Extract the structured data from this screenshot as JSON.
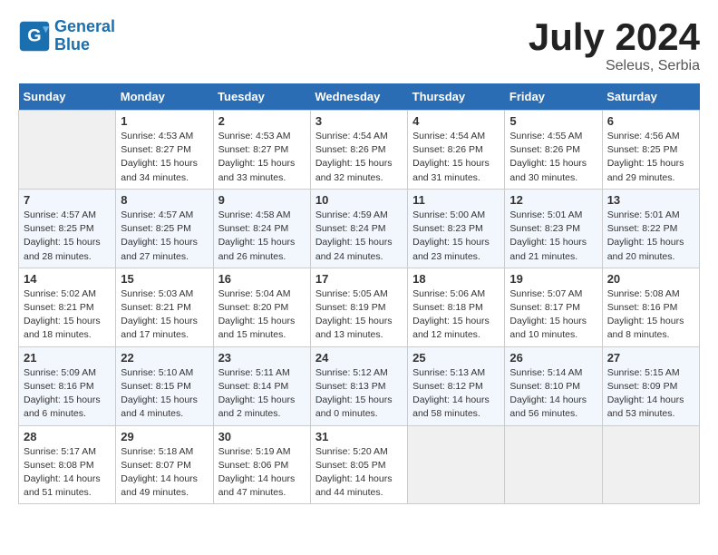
{
  "logo": {
    "line1": "General",
    "line2": "Blue"
  },
  "title": "July 2024",
  "subtitle": "Seleus, Serbia",
  "headers": [
    "Sunday",
    "Monday",
    "Tuesday",
    "Wednesday",
    "Thursday",
    "Friday",
    "Saturday"
  ],
  "weeks": [
    [
      {
        "day": "",
        "sunrise": "",
        "sunset": "",
        "daylight": ""
      },
      {
        "day": "1",
        "sunrise": "Sunrise: 4:53 AM",
        "sunset": "Sunset: 8:27 PM",
        "daylight": "Daylight: 15 hours and 34 minutes."
      },
      {
        "day": "2",
        "sunrise": "Sunrise: 4:53 AM",
        "sunset": "Sunset: 8:27 PM",
        "daylight": "Daylight: 15 hours and 33 minutes."
      },
      {
        "day": "3",
        "sunrise": "Sunrise: 4:54 AM",
        "sunset": "Sunset: 8:26 PM",
        "daylight": "Daylight: 15 hours and 32 minutes."
      },
      {
        "day": "4",
        "sunrise": "Sunrise: 4:54 AM",
        "sunset": "Sunset: 8:26 PM",
        "daylight": "Daylight: 15 hours and 31 minutes."
      },
      {
        "day": "5",
        "sunrise": "Sunrise: 4:55 AM",
        "sunset": "Sunset: 8:26 PM",
        "daylight": "Daylight: 15 hours and 30 minutes."
      },
      {
        "day": "6",
        "sunrise": "Sunrise: 4:56 AM",
        "sunset": "Sunset: 8:25 PM",
        "daylight": "Daylight: 15 hours and 29 minutes."
      }
    ],
    [
      {
        "day": "7",
        "sunrise": "Sunrise: 4:57 AM",
        "sunset": "Sunset: 8:25 PM",
        "daylight": "Daylight: 15 hours and 28 minutes."
      },
      {
        "day": "8",
        "sunrise": "Sunrise: 4:57 AM",
        "sunset": "Sunset: 8:25 PM",
        "daylight": "Daylight: 15 hours and 27 minutes."
      },
      {
        "day": "9",
        "sunrise": "Sunrise: 4:58 AM",
        "sunset": "Sunset: 8:24 PM",
        "daylight": "Daylight: 15 hours and 26 minutes."
      },
      {
        "day": "10",
        "sunrise": "Sunrise: 4:59 AM",
        "sunset": "Sunset: 8:24 PM",
        "daylight": "Daylight: 15 hours and 24 minutes."
      },
      {
        "day": "11",
        "sunrise": "Sunrise: 5:00 AM",
        "sunset": "Sunset: 8:23 PM",
        "daylight": "Daylight: 15 hours and 23 minutes."
      },
      {
        "day": "12",
        "sunrise": "Sunrise: 5:01 AM",
        "sunset": "Sunset: 8:23 PM",
        "daylight": "Daylight: 15 hours and 21 minutes."
      },
      {
        "day": "13",
        "sunrise": "Sunrise: 5:01 AM",
        "sunset": "Sunset: 8:22 PM",
        "daylight": "Daylight: 15 hours and 20 minutes."
      }
    ],
    [
      {
        "day": "14",
        "sunrise": "Sunrise: 5:02 AM",
        "sunset": "Sunset: 8:21 PM",
        "daylight": "Daylight: 15 hours and 18 minutes."
      },
      {
        "day": "15",
        "sunrise": "Sunrise: 5:03 AM",
        "sunset": "Sunset: 8:21 PM",
        "daylight": "Daylight: 15 hours and 17 minutes."
      },
      {
        "day": "16",
        "sunrise": "Sunrise: 5:04 AM",
        "sunset": "Sunset: 8:20 PM",
        "daylight": "Daylight: 15 hours and 15 minutes."
      },
      {
        "day": "17",
        "sunrise": "Sunrise: 5:05 AM",
        "sunset": "Sunset: 8:19 PM",
        "daylight": "Daylight: 15 hours and 13 minutes."
      },
      {
        "day": "18",
        "sunrise": "Sunrise: 5:06 AM",
        "sunset": "Sunset: 8:18 PM",
        "daylight": "Daylight: 15 hours and 12 minutes."
      },
      {
        "day": "19",
        "sunrise": "Sunrise: 5:07 AM",
        "sunset": "Sunset: 8:17 PM",
        "daylight": "Daylight: 15 hours and 10 minutes."
      },
      {
        "day": "20",
        "sunrise": "Sunrise: 5:08 AM",
        "sunset": "Sunset: 8:16 PM",
        "daylight": "Daylight: 15 hours and 8 minutes."
      }
    ],
    [
      {
        "day": "21",
        "sunrise": "Sunrise: 5:09 AM",
        "sunset": "Sunset: 8:16 PM",
        "daylight": "Daylight: 15 hours and 6 minutes."
      },
      {
        "day": "22",
        "sunrise": "Sunrise: 5:10 AM",
        "sunset": "Sunset: 8:15 PM",
        "daylight": "Daylight: 15 hours and 4 minutes."
      },
      {
        "day": "23",
        "sunrise": "Sunrise: 5:11 AM",
        "sunset": "Sunset: 8:14 PM",
        "daylight": "Daylight: 15 hours and 2 minutes."
      },
      {
        "day": "24",
        "sunrise": "Sunrise: 5:12 AM",
        "sunset": "Sunset: 8:13 PM",
        "daylight": "Daylight: 15 hours and 0 minutes."
      },
      {
        "day": "25",
        "sunrise": "Sunrise: 5:13 AM",
        "sunset": "Sunset: 8:12 PM",
        "daylight": "Daylight: 14 hours and 58 minutes."
      },
      {
        "day": "26",
        "sunrise": "Sunrise: 5:14 AM",
        "sunset": "Sunset: 8:10 PM",
        "daylight": "Daylight: 14 hours and 56 minutes."
      },
      {
        "day": "27",
        "sunrise": "Sunrise: 5:15 AM",
        "sunset": "Sunset: 8:09 PM",
        "daylight": "Daylight: 14 hours and 53 minutes."
      }
    ],
    [
      {
        "day": "28",
        "sunrise": "Sunrise: 5:17 AM",
        "sunset": "Sunset: 8:08 PM",
        "daylight": "Daylight: 14 hours and 51 minutes."
      },
      {
        "day": "29",
        "sunrise": "Sunrise: 5:18 AM",
        "sunset": "Sunset: 8:07 PM",
        "daylight": "Daylight: 14 hours and 49 minutes."
      },
      {
        "day": "30",
        "sunrise": "Sunrise: 5:19 AM",
        "sunset": "Sunset: 8:06 PM",
        "daylight": "Daylight: 14 hours and 47 minutes."
      },
      {
        "day": "31",
        "sunrise": "Sunrise: 5:20 AM",
        "sunset": "Sunset: 8:05 PM",
        "daylight": "Daylight: 14 hours and 44 minutes."
      },
      {
        "day": "",
        "sunrise": "",
        "sunset": "",
        "daylight": ""
      },
      {
        "day": "",
        "sunrise": "",
        "sunset": "",
        "daylight": ""
      },
      {
        "day": "",
        "sunrise": "",
        "sunset": "",
        "daylight": ""
      }
    ]
  ]
}
